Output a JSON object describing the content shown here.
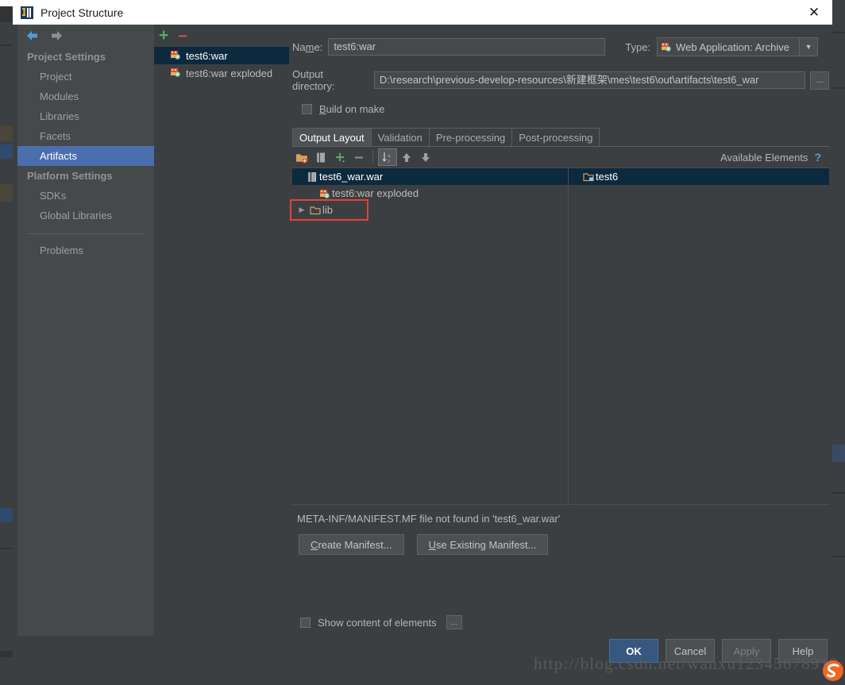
{
  "window": {
    "title": "Project Structure",
    "logo_icon": "intellij-idea-logo",
    "close_icon": "close-icon"
  },
  "nav": {
    "back_icon": "arrow-left-icon",
    "forward_icon": "arrow-right-icon",
    "groups": [
      {
        "label": "Project Settings",
        "items": [
          {
            "label": "Project",
            "selected": false
          },
          {
            "label": "Modules",
            "selected": false
          },
          {
            "label": "Libraries",
            "selected": false
          },
          {
            "label": "Facets",
            "selected": false
          },
          {
            "label": "Artifacts",
            "selected": true
          }
        ]
      },
      {
        "label": "Platform Settings",
        "items": [
          {
            "label": "SDKs",
            "selected": false
          },
          {
            "label": "Global Libraries",
            "selected": false
          }
        ]
      }
    ],
    "problems_label": "Problems"
  },
  "artifacts": {
    "add_icon": "plus-icon",
    "remove_icon": "minus-icon",
    "items": [
      {
        "label": "test6:war",
        "icon": "war-artifact-icon",
        "selected": true
      },
      {
        "label": "test6:war exploded",
        "icon": "war-exploded-artifact-icon",
        "selected": false
      }
    ]
  },
  "details": {
    "name_label": "Name:",
    "name_value": "test6:war",
    "type_label": "Type:",
    "type_value": "Web Application: Archive",
    "type_icon": "war-artifact-icon",
    "type_arrow_icon": "chevron-down-icon",
    "output_dir_label": "Output directory:",
    "output_dir_value": "D:\\research\\previous-develop-resources\\新建框架\\mes\\test6\\out\\artifacts\\test6_war",
    "output_dir_browse_label": "...",
    "build_on_make_label": "Build on make",
    "build_on_make_checked": false
  },
  "tabs": [
    {
      "label": "Output Layout",
      "active": true
    },
    {
      "label": "Validation",
      "active": false
    },
    {
      "label": "Pre-processing",
      "active": false
    },
    {
      "label": "Post-processing",
      "active": false
    }
  ],
  "elements_toolbar": {
    "buttons": [
      {
        "icon": "create-directory-icon",
        "name": "create-directory-button",
        "boxed": false
      },
      {
        "icon": "create-archive-icon",
        "name": "create-archive-button",
        "boxed": false
      },
      {
        "icon": "plus-icon",
        "name": "add-copy-of-button",
        "boxed": false
      },
      {
        "icon": "minus-icon",
        "name": "remove-button",
        "boxed": false
      },
      {
        "icon": "sort-az-icon",
        "name": "sort-button",
        "boxed": true
      },
      {
        "icon": "arrow-up-icon",
        "name": "move-up-button",
        "boxed": false
      },
      {
        "icon": "arrow-down-icon",
        "name": "move-down-button",
        "boxed": false
      }
    ],
    "available_elements_label": "Available Elements",
    "help_icon": "question-mark-icon"
  },
  "output_layout_tree": [
    {
      "label": "test6_war.war",
      "icon": "archive-icon",
      "indent": 0,
      "selected": true,
      "twisty": ""
    },
    {
      "label": "test6:war exploded",
      "icon": "war-exploded-artifact-icon",
      "indent": 1,
      "selected": false,
      "twisty": ""
    },
    {
      "label": "lib",
      "icon": "folder-icon",
      "indent": 1,
      "selected": false,
      "twisty": "▶",
      "highlighted": true
    }
  ],
  "available_elements_tree": [
    {
      "label": "test6",
      "icon": "module-folder-icon",
      "selected": true
    }
  ],
  "manifest": {
    "message": "META-INF/MANIFEST.MF file not found in 'test6_war.war'",
    "create_label": "Create Manifest...",
    "use_existing_label": "Use Existing Manifest..."
  },
  "show_content": {
    "label": "Show content of elements",
    "checked": false,
    "browse_label": "..."
  },
  "footer": {
    "ok_label": "OK",
    "cancel_label": "Cancel",
    "apply_label": "Apply",
    "help_label": "Help"
  },
  "watermark": {
    "text": "http://blog.csdn.net/wanxu12345678910"
  },
  "colors": {
    "accent_blue": "#4b6eaf",
    "selection_dark": "#0d293e",
    "highlight_red": "#e8403a",
    "green_plus": "#59a869",
    "red_minus": "#c75450",
    "dialog_bg": "#3c3f41",
    "primary_button": "#365880"
  }
}
